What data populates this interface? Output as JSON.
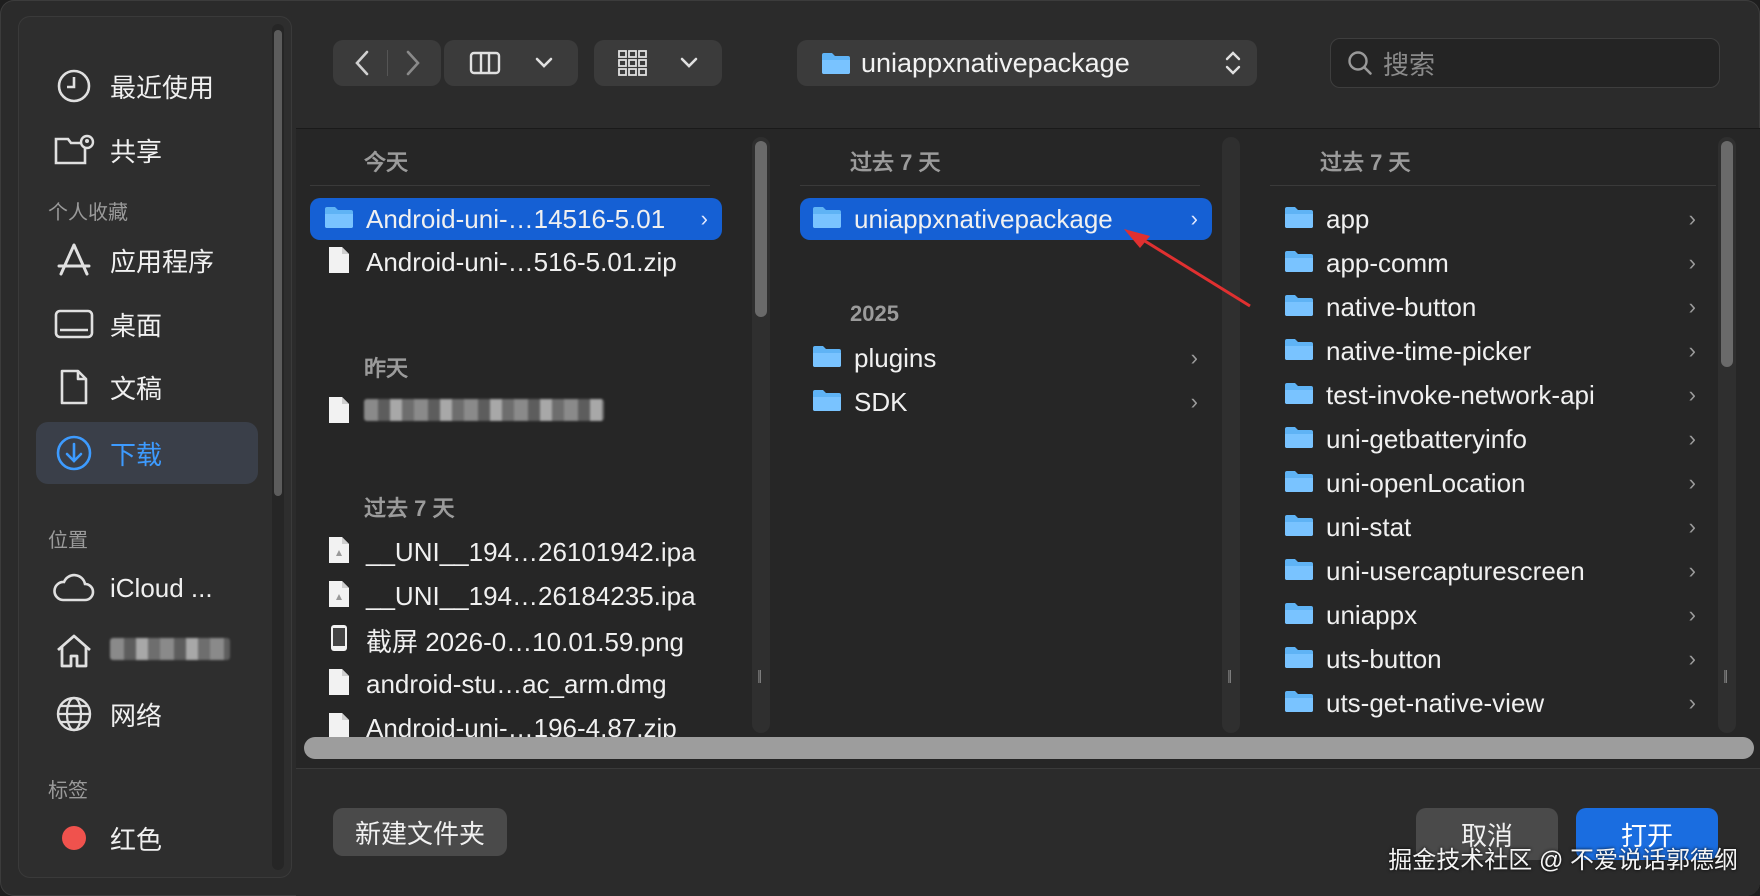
{
  "sidebar": {
    "items_top": [
      {
        "label": "最近使用",
        "icon": "clock-icon"
      },
      {
        "label": "共享",
        "icon": "shared-folder-icon"
      }
    ],
    "favorites_header": "个人收藏",
    "favorites": [
      {
        "label": "应用程序",
        "icon": "applications-icon"
      },
      {
        "label": "桌面",
        "icon": "desktop-icon"
      },
      {
        "label": "文稿",
        "icon": "document-icon"
      },
      {
        "label": "下载",
        "icon": "download-icon",
        "active": true
      }
    ],
    "locations_header": "位置",
    "locations": [
      {
        "label": "iCloud ...",
        "icon": "cloud-icon"
      },
      {
        "label": "",
        "icon": "home-icon",
        "blurred": true
      },
      {
        "label": "网络",
        "icon": "globe-icon"
      }
    ],
    "tags_header": "标签",
    "tags": [
      {
        "label": "红色",
        "color": "#f0524d"
      }
    ]
  },
  "toolbar": {
    "back_icon": "chevron-left-icon",
    "forward_icon": "chevron-right-icon",
    "view_icon": "columns-view-icon",
    "group_icon": "grid-icon",
    "path_label": "uniappxnativepackage",
    "search_placeholder": "搜索"
  },
  "columns": [
    {
      "groups": [
        {
          "header": "今天",
          "rows": [
            {
              "name": "Android-uni-…14516-5.01",
              "type": "folder",
              "selected": true
            },
            {
              "name": "Android-uni-…516-5.01.zip",
              "type": "file"
            }
          ]
        },
        {
          "header": "昨天",
          "rows": [
            {
              "name": "",
              "type": "file",
              "blurred": true
            }
          ]
        },
        {
          "header": "过去 7 天",
          "rows": [
            {
              "name": "__UNI__194…26101942.ipa",
              "type": "file"
            },
            {
              "name": "__UNI__194…26184235.ipa",
              "type": "file"
            },
            {
              "name": "截屏 2026-0…10.01.59.png",
              "type": "image"
            },
            {
              "name": "android-stu…ac_arm.dmg",
              "type": "file"
            },
            {
              "name": "Android-uni-…196-4.87.zip",
              "type": "file"
            }
          ]
        }
      ]
    },
    {
      "groups": [
        {
          "header": "过去 7 天",
          "rows": [
            {
              "name": "uniappxnativepackage",
              "type": "folder",
              "selected": true
            }
          ]
        },
        {
          "header": "2025",
          "rows": [
            {
              "name": "plugins",
              "type": "folder"
            },
            {
              "name": "SDK",
              "type": "folder"
            }
          ]
        }
      ]
    },
    {
      "groups": [
        {
          "header": "过去 7 天",
          "rows": [
            {
              "name": "app",
              "type": "folder"
            },
            {
              "name": "app-comm",
              "type": "folder"
            },
            {
              "name": "native-button",
              "type": "folder"
            },
            {
              "name": "native-time-picker",
              "type": "folder"
            },
            {
              "name": "test-invoke-network-api",
              "type": "folder"
            },
            {
              "name": "uni-getbatteryinfo",
              "type": "folder"
            },
            {
              "name": "uni-openLocation",
              "type": "folder"
            },
            {
              "name": "uni-stat",
              "type": "folder"
            },
            {
              "name": "uni-usercapturescreen",
              "type": "folder"
            },
            {
              "name": "uniappx",
              "type": "folder"
            },
            {
              "name": "uts-button",
              "type": "folder"
            },
            {
              "name": "uts-get-native-view",
              "type": "folder"
            }
          ]
        }
      ]
    }
  ],
  "footer": {
    "new_folder": "新建文件夹",
    "cancel": "取消",
    "open": "打开"
  },
  "watermark": "掘金技术社区 @ 不爱说话郭德纲",
  "colors": {
    "accent": "#1560d4",
    "active_text": "#3d9bff",
    "annotation_arrow": "#e03030"
  }
}
